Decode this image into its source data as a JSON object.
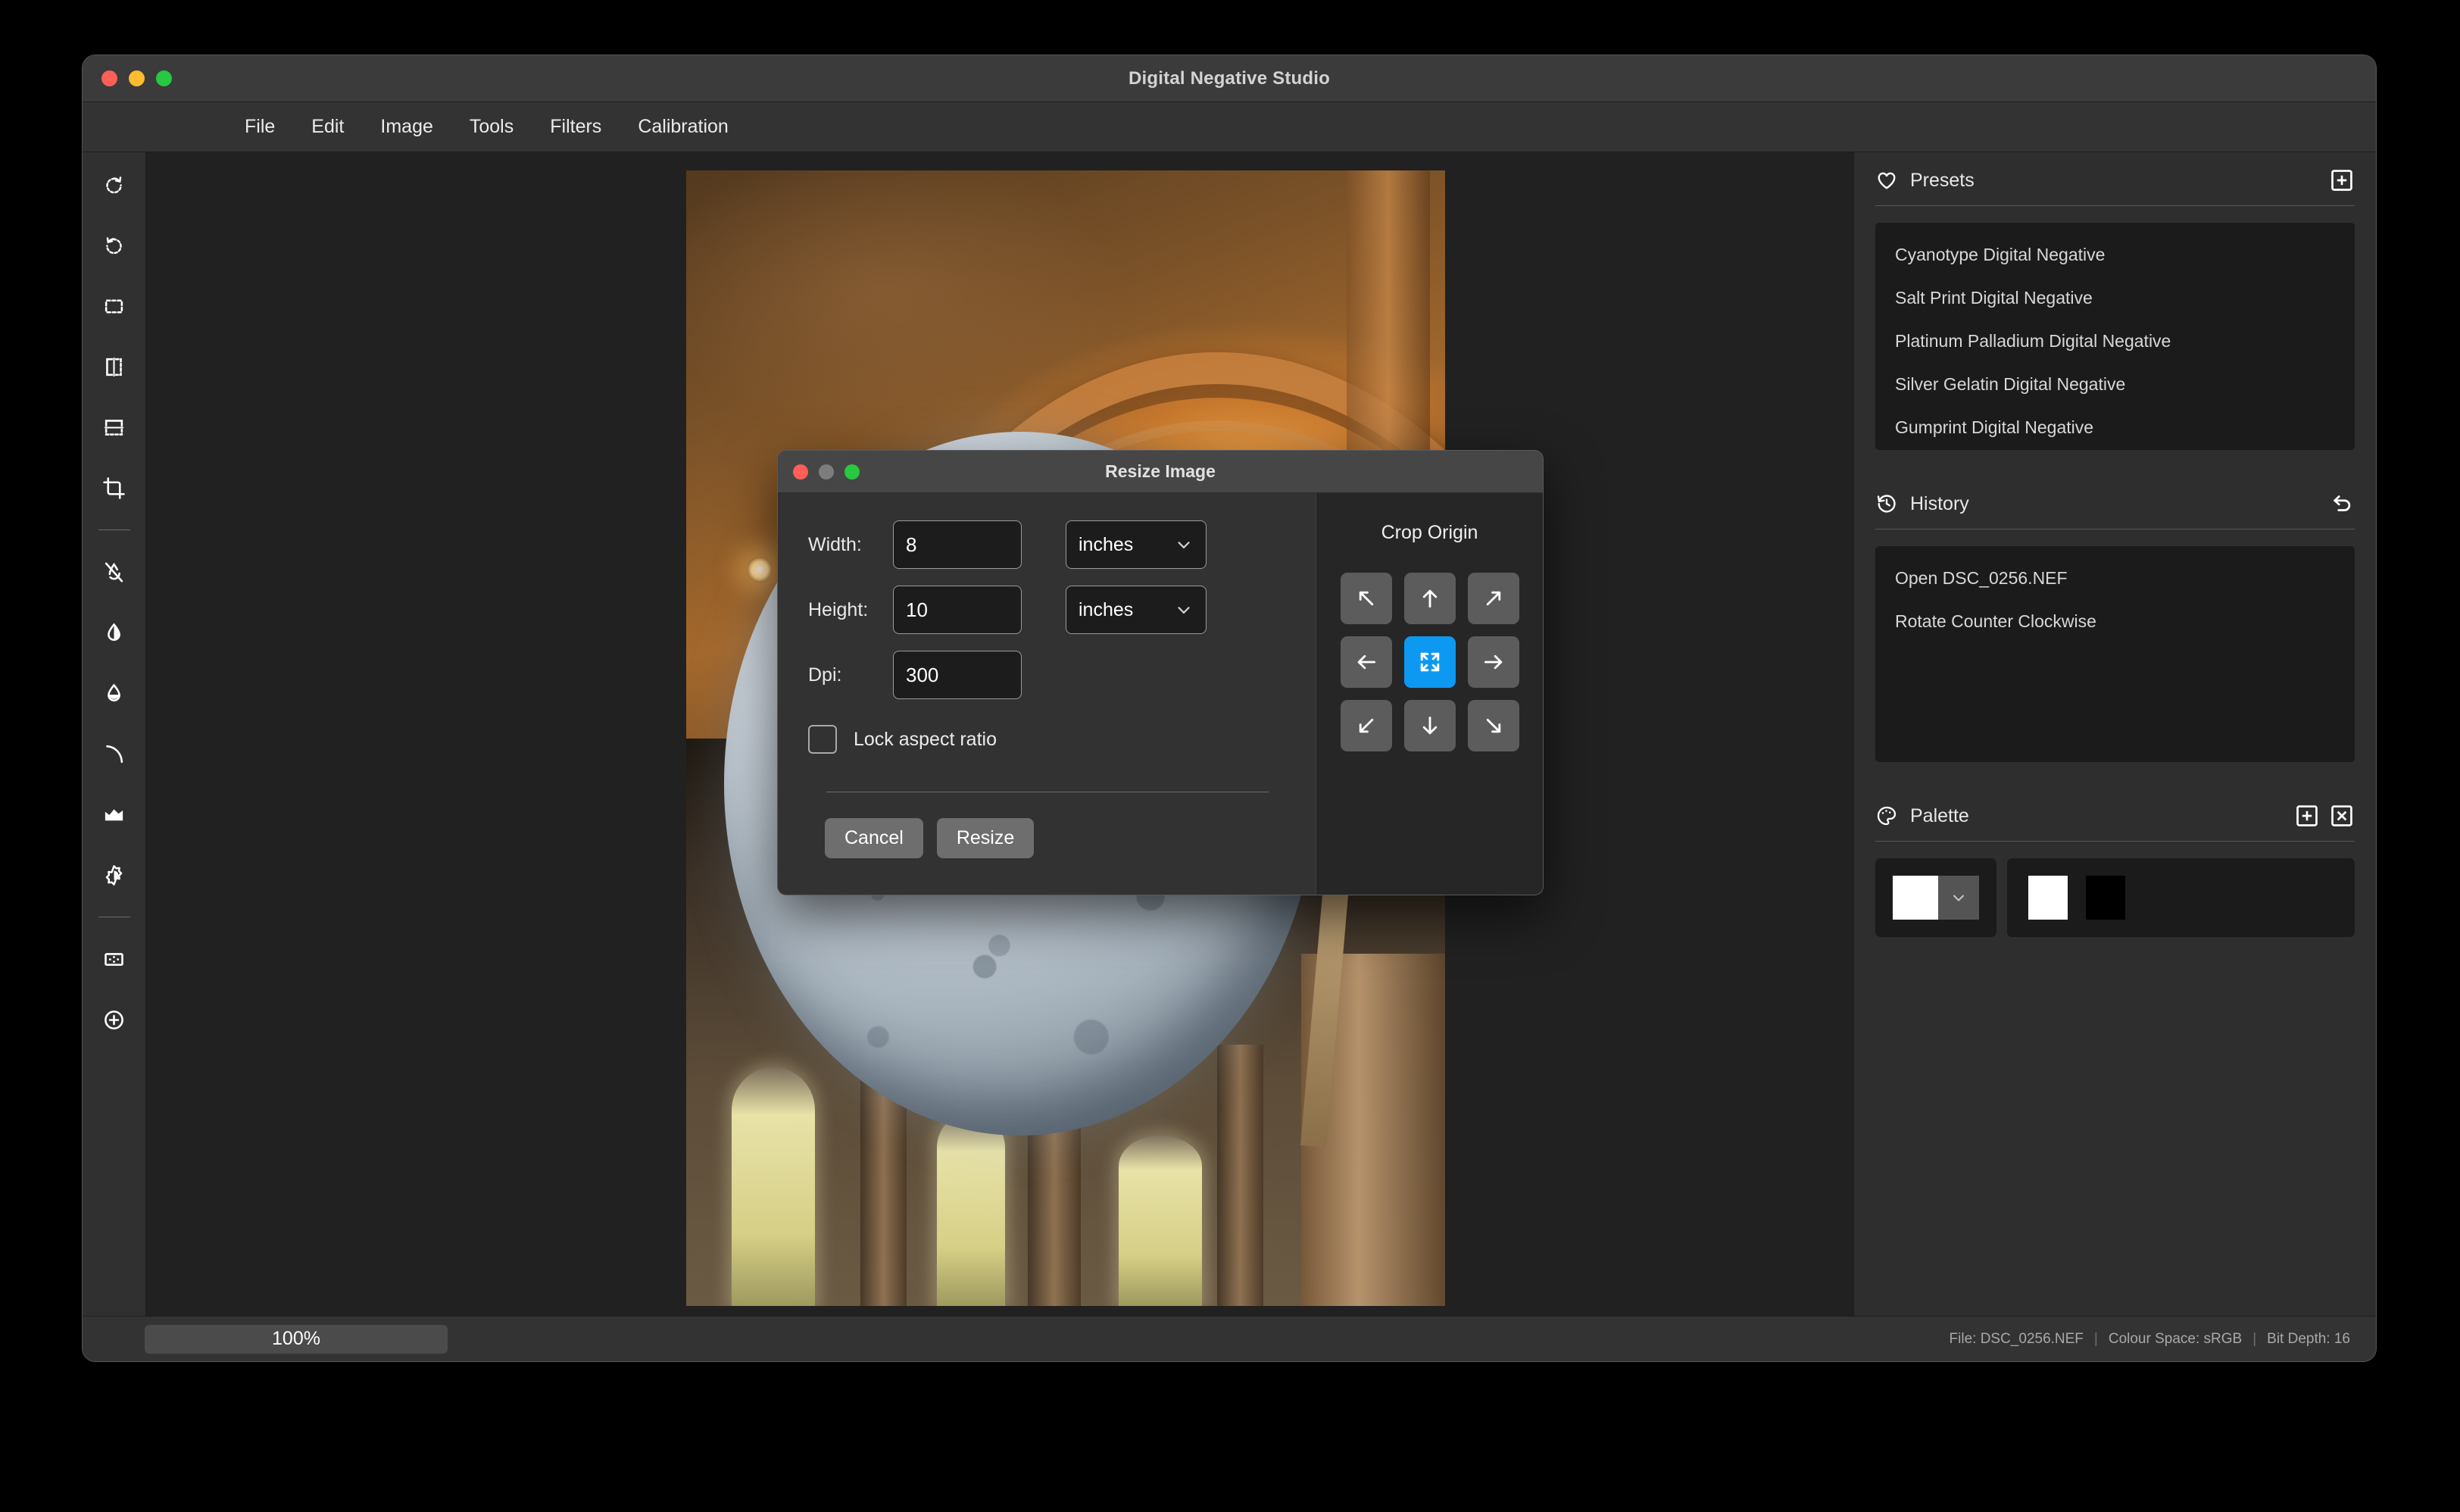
{
  "window": {
    "title": "Digital Negative Studio",
    "traffic_lights": [
      "close-red",
      "minimize-yellow",
      "maximize-green"
    ]
  },
  "menubar": {
    "items": [
      {
        "label": "File",
        "name": "menu-file"
      },
      {
        "label": "Edit",
        "name": "menu-edit"
      },
      {
        "label": "Image",
        "name": "menu-image"
      },
      {
        "label": "Tools",
        "name": "menu-tools"
      },
      {
        "label": "Filters",
        "name": "menu-filters"
      },
      {
        "label": "Calibration",
        "name": "menu-calibration"
      }
    ]
  },
  "toolbar": {
    "tools": [
      {
        "icon": "rotate-clockwise-icon"
      },
      {
        "icon": "rotate-counter-clockwise-icon"
      },
      {
        "icon": "selection-marquee-icon"
      },
      {
        "icon": "flip-horizontal-icon"
      },
      {
        "icon": "flip-vertical-icon"
      },
      {
        "icon": "crop-icon"
      },
      {
        "icon": "divider"
      },
      {
        "icon": "blur-off-icon"
      },
      {
        "icon": "contrast-droplet-icon"
      },
      {
        "icon": "saturation-droplet-icon"
      },
      {
        "icon": "curve-icon"
      },
      {
        "icon": "levels-histogram-icon"
      },
      {
        "icon": "brightness-icon"
      },
      {
        "icon": "divider"
      },
      {
        "icon": "grain-icon"
      },
      {
        "icon": "add-circle-icon"
      }
    ]
  },
  "canvas": {
    "photo_description": "Suspended illuminated moon sculpture inside a warmly lit cathedral nave"
  },
  "presets": {
    "title": "Presets",
    "icon": "heart-icon",
    "add_button": "add-preset-icon",
    "items": [
      "Cyanotype Digital Negative",
      "Salt Print Digital Negative",
      "Platinum Palladium Digital Negative",
      "Silver Gelatin Digital Negative",
      "Gumprint Digital Negative"
    ]
  },
  "history": {
    "title": "History",
    "icon": "clock-rewind-icon",
    "undo_button": "undo-icon",
    "items": [
      "Open DSC_0256.NEF",
      "Rotate Counter Clockwise"
    ]
  },
  "palette": {
    "title": "Palette",
    "icon": "palette-icon",
    "add_button": "add-colour-icon",
    "remove_button": "remove-colour-icon",
    "picker_colour": "#ffffff",
    "swatches": [
      "#ffffff",
      "#000000"
    ]
  },
  "statusbar": {
    "zoom": "100%",
    "file_label": "File: DSC_0256.NEF",
    "colour_space_label": "Colour Space: sRGB",
    "bit_depth_label": "Bit Depth: 16",
    "separator": "|"
  },
  "dialog": {
    "title": "Resize Image",
    "traffic_lights": [
      "close-red",
      "minimize-grey",
      "maximize-green"
    ],
    "width": {
      "label": "Width:",
      "value": "8",
      "unit": "inches",
      "placeholder": "Width"
    },
    "height": {
      "label": "Height:",
      "value": "10",
      "unit": "inches",
      "placeholder": "Height"
    },
    "dpi": {
      "label": "Dpi:",
      "value": "300",
      "placeholder": "Dpi"
    },
    "lock_aspect_ratio": {
      "label": "Lock aspect ratio",
      "checked": false
    },
    "cancel_label": "Cancel",
    "resize_label": "Resize",
    "crop_origin": {
      "title": "Crop Origin",
      "selected": "center",
      "accent_colour": "#0d99f2",
      "cells": [
        {
          "key": "top-left",
          "icon": "arrow-up-left-icon"
        },
        {
          "key": "top-center",
          "icon": "arrow-up-icon"
        },
        {
          "key": "top-right",
          "icon": "arrow-up-right-icon"
        },
        {
          "key": "middle-left",
          "icon": "arrow-left-icon"
        },
        {
          "key": "center",
          "icon": "expand-icon"
        },
        {
          "key": "middle-right",
          "icon": "arrow-right-icon"
        },
        {
          "key": "bottom-left",
          "icon": "arrow-down-left-icon"
        },
        {
          "key": "bottom-center",
          "icon": "arrow-down-icon"
        },
        {
          "key": "bottom-right",
          "icon": "arrow-down-right-icon"
        }
      ]
    }
  }
}
